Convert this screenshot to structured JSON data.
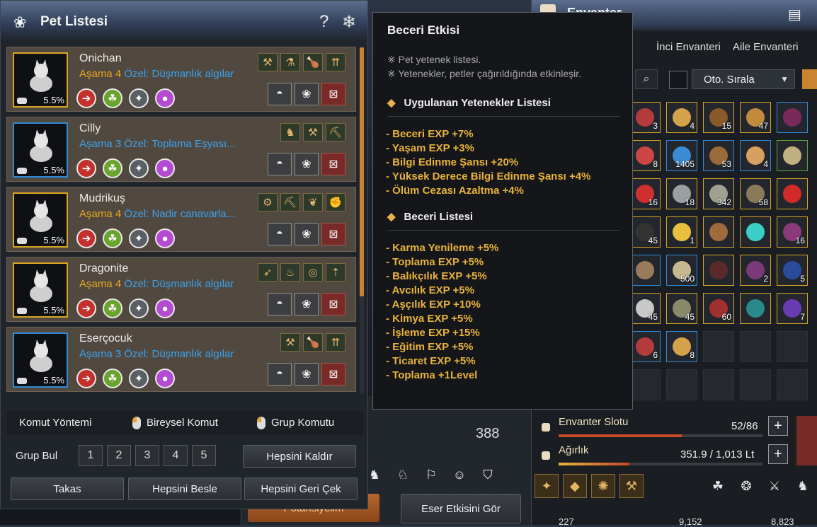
{
  "pet_panel": {
    "title": "Pet Listesi",
    "pets": [
      {
        "name": "Onichan",
        "tier": "Aşama 4",
        "special": "Özel: Düşmanlık algılar",
        "percent": "5.5%",
        "frame": "gold"
      },
      {
        "name": "Cilly",
        "tier": "Aşama 3",
        "special": "Özel: Toplama Eşyası...",
        "percent": "5.5%",
        "frame": "blue"
      },
      {
        "name": "Mudrikuş",
        "tier": "Aşama 4",
        "special": "Özel: Nadir canavarla...",
        "percent": "5.5%",
        "frame": "gold"
      },
      {
        "name": "Dragonite",
        "tier": "Aşama 4",
        "special": "Özel: Düşmanlık algılar",
        "percent": "5.5%",
        "frame": "gold"
      },
      {
        "name": "Eserçocuk",
        "tier": "Aşama 3",
        "special": "Özel: Düşmanlık algılar",
        "percent": "5.5%",
        "frame": "blue"
      }
    ],
    "command_method_label": "Komut Yöntemi",
    "individual_command_label": "Bireysel Komut",
    "group_command_label": "Grup Komutu",
    "group_find_label": "Grup Bul",
    "group_numbers": [
      "1",
      "2",
      "3",
      "4",
      "5"
    ],
    "remove_all_label": "Hepsini Kaldır",
    "trade_label": "Takas",
    "feed_all_label": "Hepsini Besle",
    "recall_all_label": "Hepsini Geri Çek"
  },
  "tooltip": {
    "title": "Beceri Etkisi",
    "notes": [
      "※ Pet yetenek listesi.",
      "※ Yetenekler, petler çağırıldığında etkinleşir."
    ],
    "applied_section": "Uygulanan Yetenekler Listesi",
    "applied": [
      "- Beceri EXP +7%",
      "- Yaşam EXP +3%",
      "- Bilgi Edinme Şansı +20%",
      "- Yüksek Derece Bilgi Edinme Şansı +4%",
      "- Ölüm Cezası Azaltma +4%"
    ],
    "skills_section": "Beceri Listesi",
    "skills": [
      "- Karma Yenileme +5%",
      "- Toplama EXP +5%",
      "- Balıkçılık EXP +5%",
      "- Avcılık EXP +5%",
      "- Aşçılık EXP +10%",
      "- Kimya EXP +5%",
      "- İşleme EXP +15%",
      "- Eğitim EXP +5%",
      "- Ticaret EXP +5%",
      "- Toplama +1Level"
    ]
  },
  "background": {
    "number": "388",
    "left_button": "Potansiyelim",
    "right_button": "Eser Etkisini Gör"
  },
  "inventory": {
    "title": "Envanter",
    "tabs": [
      "İnci Envanteri",
      "Aile Envanteri"
    ],
    "sort_label": "Oto. Sırala",
    "slot_label": "Envanter Slotu",
    "slot_value": "52/86",
    "slot_fraction": 0.6047,
    "weight_label": "Ağırlık",
    "weight_value": "351.9 / 1,013 Lt",
    "weight_fraction": 0.347,
    "item_counts": [
      "3",
      "4",
      "15",
      "47",
      "8",
      "1405",
      "53",
      "4",
      "16",
      "18",
      "342",
      "58",
      "40",
      "45",
      "1",
      "16",
      "500",
      "2",
      "5",
      "45",
      "45",
      "60",
      "7",
      "6",
      "8",
      "8"
    ],
    "bottom_values": [
      "227",
      "9,152",
      "8,823"
    ]
  },
  "colors": {
    "accent_gold": "#e9a91c",
    "accent_blue": "#3ba3f0",
    "tooltip_item": "#e9b23a"
  }
}
